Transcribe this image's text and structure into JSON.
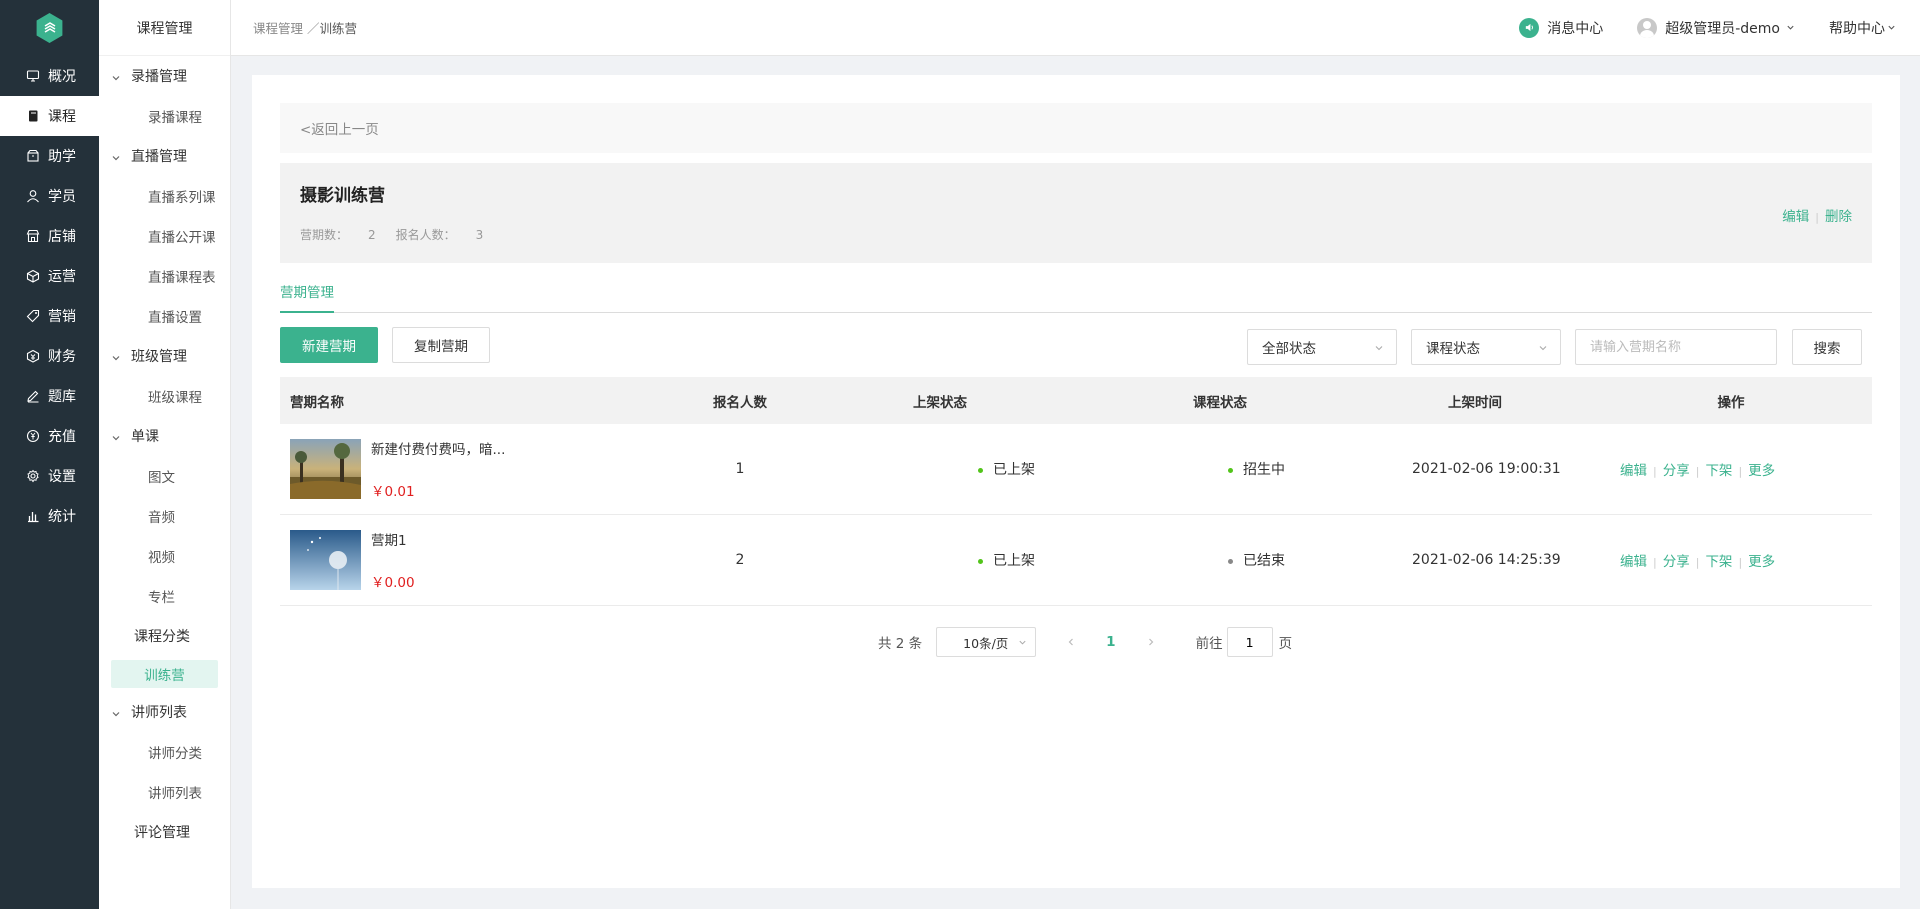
{
  "nav_primary": [
    {
      "label": "概况",
      "icon": "monitor-icon"
    },
    {
      "label": "课程",
      "icon": "book-icon",
      "active": true
    },
    {
      "label": "助学",
      "icon": "box-icon"
    },
    {
      "label": "学员",
      "icon": "user-icon"
    },
    {
      "label": "店铺",
      "icon": "shop-icon"
    },
    {
      "label": "运营",
      "icon": "cube-icon"
    },
    {
      "label": "营销",
      "icon": "tag-icon"
    },
    {
      "label": "财务",
      "icon": "wallet-icon"
    },
    {
      "label": "题库",
      "icon": "pen-icon"
    },
    {
      "label": "充值",
      "icon": "yen-icon"
    },
    {
      "label": "设置",
      "icon": "gear-icon"
    },
    {
      "label": "统计",
      "icon": "bar-chart-icon"
    }
  ],
  "nav_secondary": {
    "title": "课程管理",
    "groups": {
      "record": {
        "label": "录播管理",
        "items": [
          "录播课程"
        ]
      },
      "live": {
        "label": "直播管理",
        "items": [
          "直播系列课",
          "直播公开课",
          "直播课程表",
          "直播设置"
        ]
      },
      "class": {
        "label": "班级管理",
        "items": [
          "班级课程"
        ]
      },
      "single": {
        "label": "单课",
        "items": [
          "图文",
          "音频",
          "视频",
          "专栏"
        ]
      },
      "category": "课程分类",
      "camp": "训练营",
      "lecturer": {
        "label": "讲师列表",
        "items": [
          "讲师分类",
          "讲师列表"
        ]
      },
      "comment": "评论管理"
    }
  },
  "header": {
    "breadcrumb_parent": "课程管理",
    "breadcrumb_sep": " ／",
    "breadcrumb_current": "训练营",
    "messages": "消息中心",
    "user": "超级管理员-demo",
    "help": "帮助中心"
  },
  "back": "<返回上一页",
  "camp": {
    "title": "摄影训练营",
    "periods_label": "营期数：",
    "periods": "2",
    "signups_label": "报名人数：",
    "signups": "3",
    "edit": "编辑",
    "delete": "删除"
  },
  "tab": "营期管理",
  "toolbar": {
    "new": "新建营期",
    "copy": "复制营期",
    "status_filter": "全部状态",
    "course_status_filter": "课程状态",
    "search_placeholder": "请输入营期名称",
    "search": "搜索"
  },
  "table": {
    "headers": [
      "营期名称",
      "报名人数",
      "上架状态",
      "课程状态",
      "上架时间",
      "操作"
    ],
    "rows": [
      {
        "name": "新建付费付费吗，暗...",
        "price": "￥0.01",
        "count": "1",
        "shelf": "已上架",
        "course": "招生中",
        "course_color": "green",
        "time": "2021-02-06 19:00:31"
      },
      {
        "name": "营期1",
        "price": "￥0.00",
        "count": "2",
        "shelf": "已上架",
        "course": "已结束",
        "course_color": "gray",
        "time": "2021-02-06 14:25:39"
      }
    ],
    "ops": [
      "编辑",
      "分享",
      "下架",
      "更多"
    ]
  },
  "pager": {
    "total": "共 2 条",
    "size": "10条/页",
    "page": "1",
    "goto_label": "前往",
    "goto_value": "1",
    "page_suffix": "页"
  },
  "colors": {
    "accent": "#3bb28e",
    "sidebar": "#24313a",
    "price": "#e02020"
  }
}
